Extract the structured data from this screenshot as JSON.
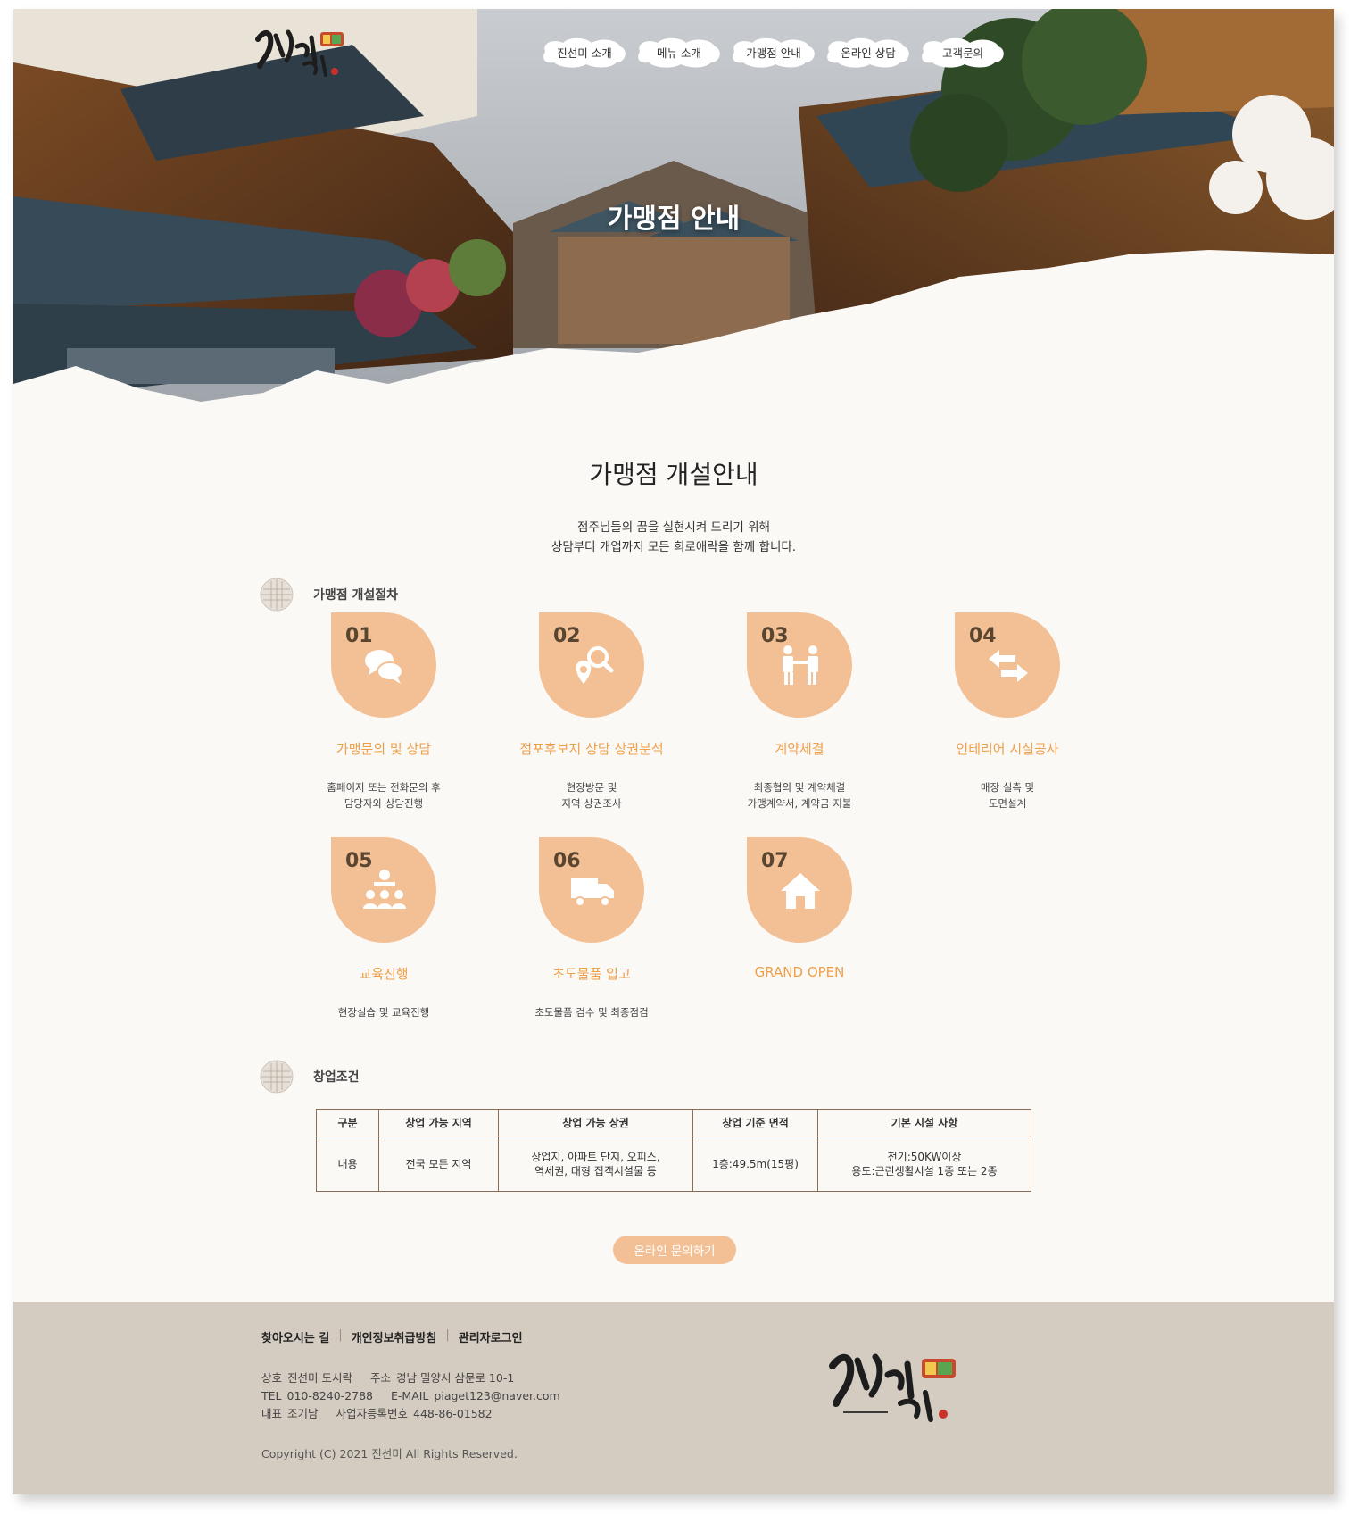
{
  "nav": {
    "items": [
      {
        "label": "진선미 소개"
      },
      {
        "label": "메뉴 소개"
      },
      {
        "label": "가맹점 안내"
      },
      {
        "label": "온라인 상담"
      },
      {
        "label": "고객문의"
      }
    ]
  },
  "hero": {
    "title": "가맹점 안내"
  },
  "section": {
    "title": "가맹점 개설안내",
    "subtitle_line1": "점주님들의 꿈을 실현시켜 드리기 위해",
    "subtitle_line2": "상담부터 개업까지 모든 희로애락을 함께 합니다."
  },
  "process": {
    "heading": "가맹점 개설절차",
    "steps": [
      {
        "num": "01",
        "title": "가맹문의 및 상담",
        "desc": "홈페이지 또는 전화문의 후\n담당자와 상담진행",
        "icon": "chat-bubbles-icon"
      },
      {
        "num": "02",
        "title": "점포후보지 상담 상권분석",
        "desc": "현장방문 및\n지역 상권조사",
        "icon": "map-search-icon"
      },
      {
        "num": "03",
        "title": "계약체결",
        "desc": "최종협의 및 계약체결\n가맹계약서, 계약금 지불",
        "icon": "handshake-icon"
      },
      {
        "num": "04",
        "title": "인테리어 시설공사",
        "desc": "매장 실측 및\n도면설계",
        "icon": "exchange-arrows-icon"
      },
      {
        "num": "05",
        "title": "교육진행",
        "desc": "현장실습 및 교육진행",
        "icon": "training-icon"
      },
      {
        "num": "06",
        "title": "초도물품 입고",
        "desc": "초도물품 검수 및 최종점검",
        "icon": "truck-icon"
      },
      {
        "num": "07",
        "title": "GRAND OPEN",
        "desc": "",
        "icon": "house-icon"
      }
    ]
  },
  "conditions": {
    "heading": "창업조건",
    "headers": [
      "구분",
      "창업 가능 지역",
      "창업 가능 상권",
      "창업 기준 면적",
      "기본 시설 사항"
    ],
    "row": [
      "내용",
      "전국 모든 지역",
      "상업지, 아파트 단지, 오피스,\n역세권, 대형 집객시설물 등",
      "1층:49.5m(15평)",
      "전기:50KW이상\n용도:근린생활시설 1종 또는 2종"
    ]
  },
  "cta": {
    "label": "온라인 문의하기"
  },
  "footer": {
    "links": [
      "찾아오시는 길",
      "개인정보취급방침",
      "관리자로그인"
    ],
    "info": {
      "company_label": "상호",
      "company": "진선미 도시락",
      "address_label": "주소",
      "address": "경남 밀양시 삼문로 10-1",
      "tel_label": "TEL",
      "tel": "010-8240-2788",
      "email_label": "E-MAIL",
      "email": "piaget123@naver.com",
      "ceo_label": "대표",
      "ceo": "조기남",
      "bizno_label": "사업자등록번호",
      "bizno": "448-86-01582"
    },
    "copyright": "Copyright (C) 2021 진선미 All Rights Reserved."
  },
  "colors": {
    "accent": "#ee9f4a",
    "badge": "#f3c095",
    "underline": "#f0b24a",
    "footer_bg": "#d5ccc1",
    "page_bg": "#fbf9f6"
  }
}
